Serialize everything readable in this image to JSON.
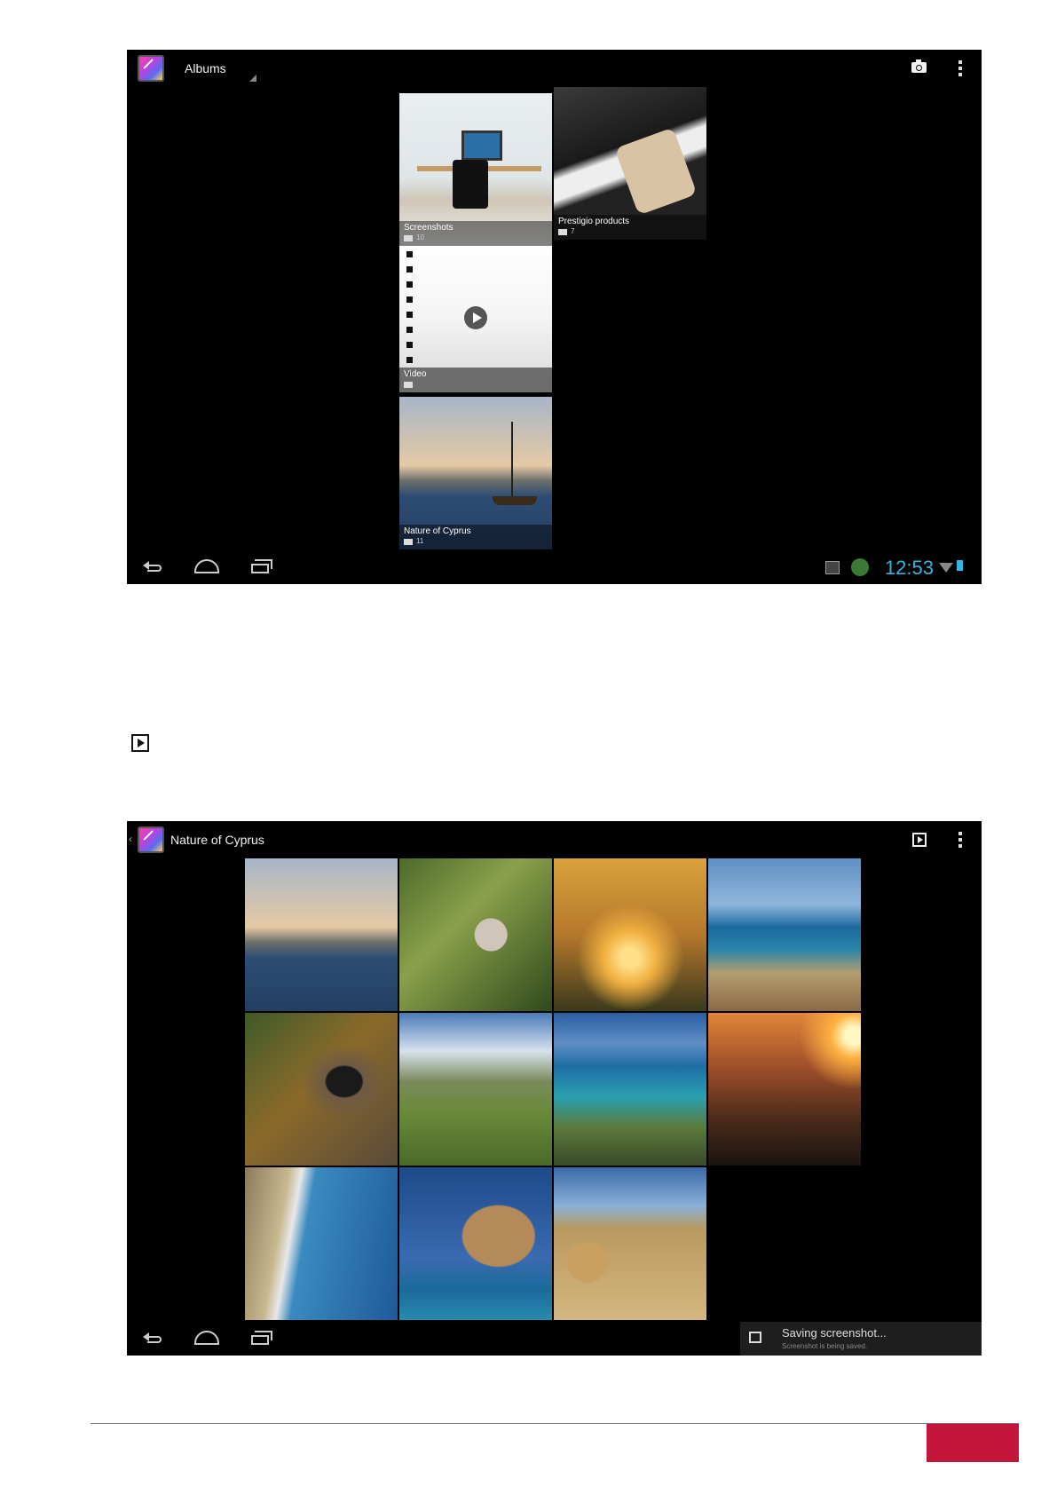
{
  "screenshot_albums": {
    "action_bar": {
      "title": "Albums",
      "icons": [
        "gallery-app-icon",
        "dropdown-caret",
        "camera-icon",
        "overflow-menu-icon"
      ]
    },
    "albums": [
      {
        "title": "Screenshots",
        "count": "10"
      },
      {
        "title": "Prestigio products",
        "count": "7"
      },
      {
        "title": "Video",
        "count": ""
      },
      {
        "title": "Nature of Cyprus",
        "count": "11"
      }
    ],
    "status_bar": {
      "clock": "12:53"
    }
  },
  "screenshot_album_view": {
    "action_bar": {
      "title": "Nature of Cyprus",
      "icons": [
        "gallery-app-icon",
        "slideshow-icon",
        "overflow-menu-icon"
      ]
    },
    "photo_count": 11,
    "notification": {
      "title": "Saving screenshot...",
      "subtitle": "Screenshot is being saved."
    }
  },
  "colors": {
    "accent": "#33b5e5",
    "footer_tab": "#c4163a"
  }
}
